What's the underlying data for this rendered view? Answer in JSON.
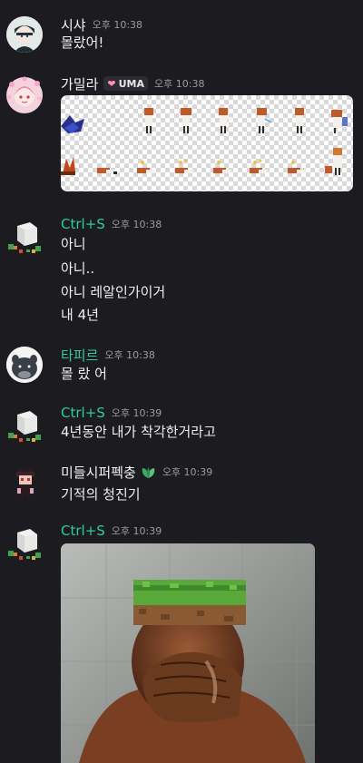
{
  "messages": [
    {
      "username": "시샤",
      "timestamp": "오후 10:38",
      "lines": [
        "몰랐어!"
      ]
    },
    {
      "username": "가밀라",
      "timestamp": "오후 10:38",
      "tag": "UMA",
      "attachment": "sprite-sheet"
    },
    {
      "username": "Ctrl+S",
      "timestamp": "오후 10:38",
      "lines": [
        "아니",
        "아니..",
        "아니 레알인가이거",
        "내 4년"
      ]
    },
    {
      "username": "타피르",
      "timestamp": "오후 10:38",
      "lines": [
        "몰 랐 어"
      ]
    },
    {
      "username": "Ctrl+S",
      "timestamp": "오후 10:39",
      "lines": [
        "4년동안 내가 착각한거라고"
      ]
    },
    {
      "username": "미들시퍼펙충",
      "timestamp": "오후 10:39",
      "lines": [
        "기적의 청진기"
      ]
    },
    {
      "username": "Ctrl+S",
      "timestamp": "오후 10:39",
      "attachment": "photo"
    }
  ],
  "colors": {
    "background": "#1c1c20",
    "username_default": "#f2f3f5",
    "username_green": "#2ecc9a",
    "timestamp": "#9a9ca3",
    "tag_heart": "#ff8fbd"
  },
  "icons": [
    "heart-icon",
    "leaf-icon"
  ]
}
